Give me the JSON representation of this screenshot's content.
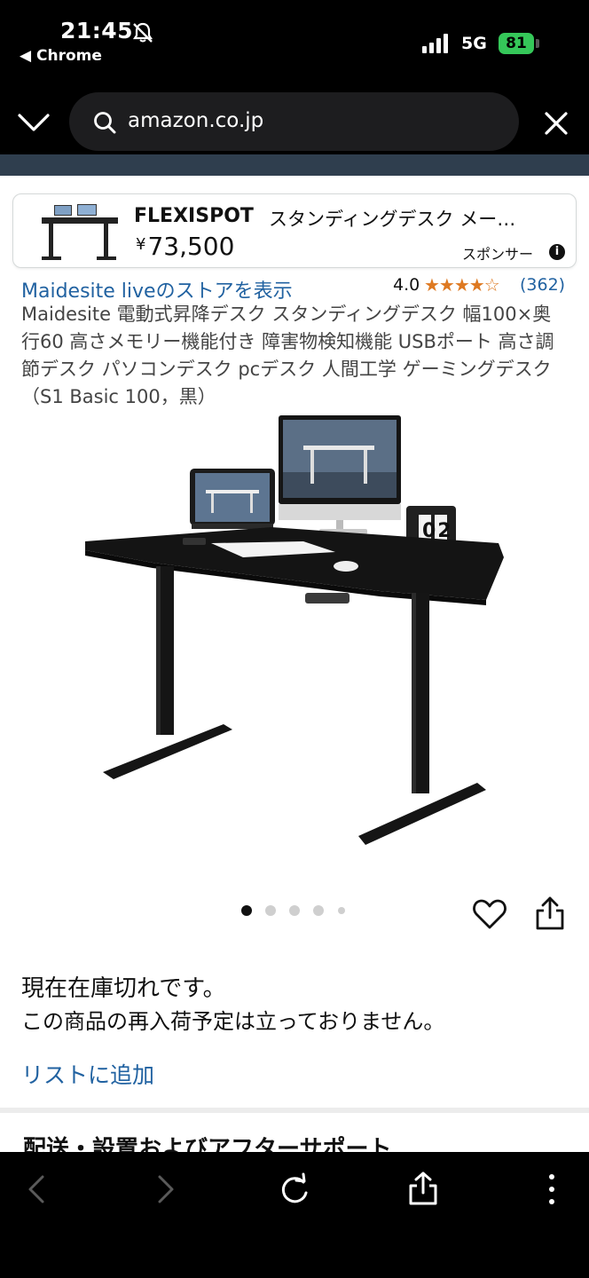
{
  "status_bar": {
    "time": "21:45",
    "back_app": "◀ Chrome",
    "network": "5G",
    "battery": "81"
  },
  "browser": {
    "url": "amazon.co.jp"
  },
  "sponsor": {
    "brand": "FLEXISPOT",
    "title": "スタンディングデスク メー…",
    "price_symbol": "¥",
    "price": "73,500",
    "label": "スポンサー",
    "info_glyph": "i"
  },
  "product": {
    "store_link": "Maidesite liveのストアを表示",
    "rating": "4.0",
    "stars": "★★★★",
    "star_empty": "☆",
    "review_count": "(362)",
    "title": "Maidesite 電動式昇降デスク スタンディングデスク 幅100×奥行60 高さメモリー機能付き 障害物検知機能 USBポート 高さ調節デスク パソコンデスク pcデスク 人間工学 ゲーミングデスク（S1 Basic 100，黒）",
    "stock_line1": "現在在庫切れです。",
    "stock_line2": "この商品の再入荷予定は立っておりません。",
    "add_to_list": "リストに追加",
    "section_heading": "配送・設置およびアフターサポート",
    "clock_digits": "02"
  },
  "colors": {
    "link": "#2162a1",
    "star": "#de7921",
    "battery": "#35c759",
    "nav_strip": "#2f3e4e"
  }
}
